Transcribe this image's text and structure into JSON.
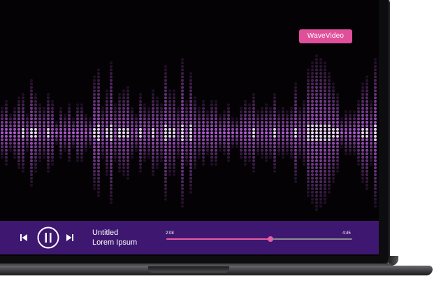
{
  "brand": {
    "label": "WaveVideo"
  },
  "player": {
    "track_title": "Untitled",
    "track_artist": "Lorem Ipsum",
    "current_time": "2:08",
    "total_time": "4:45",
    "progress": 0.56,
    "state": "playing"
  },
  "icons": {
    "previous": "skip-previous-icon",
    "pause": "pause-circle-icon",
    "next": "skip-next-icon"
  },
  "colors": {
    "screen_bg": "#050205",
    "player_bar": "#3e1770",
    "accent_pink": "#e0509a",
    "progress_fill": "#e85ca6",
    "progress_track": "#8a8a92",
    "waveform_dot": "#b25cd6",
    "waveform_core": "#f2dcff"
  }
}
